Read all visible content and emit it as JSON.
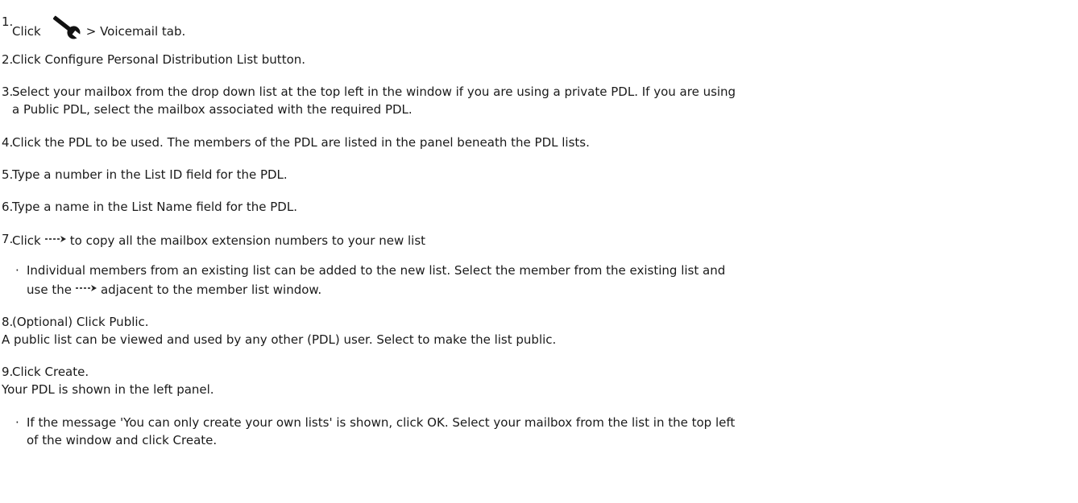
{
  "steps": [
    {
      "num": "1.",
      "pre": "Click",
      "icon": "wrench-icon",
      "post": "> Voicemail tab."
    },
    {
      "num": "2.",
      "text": "Click Configure Personal Distribution List button."
    },
    {
      "num": "3.",
      "line1": "Select your mailbox from the drop down list at the top left in the window if you are using a private PDL. If you are using",
      "line2": "a Public PDL, select the mailbox associated with the required PDL."
    },
    {
      "num": "4.",
      "text": "Click the PDL to be used. The members of the PDL are listed in the panel beneath the PDL lists."
    },
    {
      "num": "5.",
      "text": "Type a number in the List ID field for the PDL."
    },
    {
      "num": "6.",
      "text": "Type a name in the List Name field for the PDL."
    },
    {
      "num": "7.",
      "pre": "Click",
      "icon": "copy-arrow-icon",
      "post": "to copy all the mailbox extension numbers to your new list"
    },
    {
      "num": "8.",
      "line1": "(Optional) Click Public.",
      "line2": "A public list can be viewed and used by any other (PDL) user. Select to make the list public."
    },
    {
      "num": "9.",
      "line1": "Click Create.",
      "line2": "Your PDL is shown in the left panel."
    }
  ],
  "bullets": [
    {
      "dot": "·",
      "line1": "Individual members from an existing list can be added to the new list. Select the member from the existing list and",
      "line2_pre": "use the",
      "icon": "copy-arrow-icon",
      "line2_post": "adjacent to the member list window."
    },
    {
      "dot": "·",
      "line1": "If the message 'You can only create your own lists' is shown, click OK. Select your mailbox from the list in the top left",
      "line2": "of the window and click Create."
    }
  ]
}
